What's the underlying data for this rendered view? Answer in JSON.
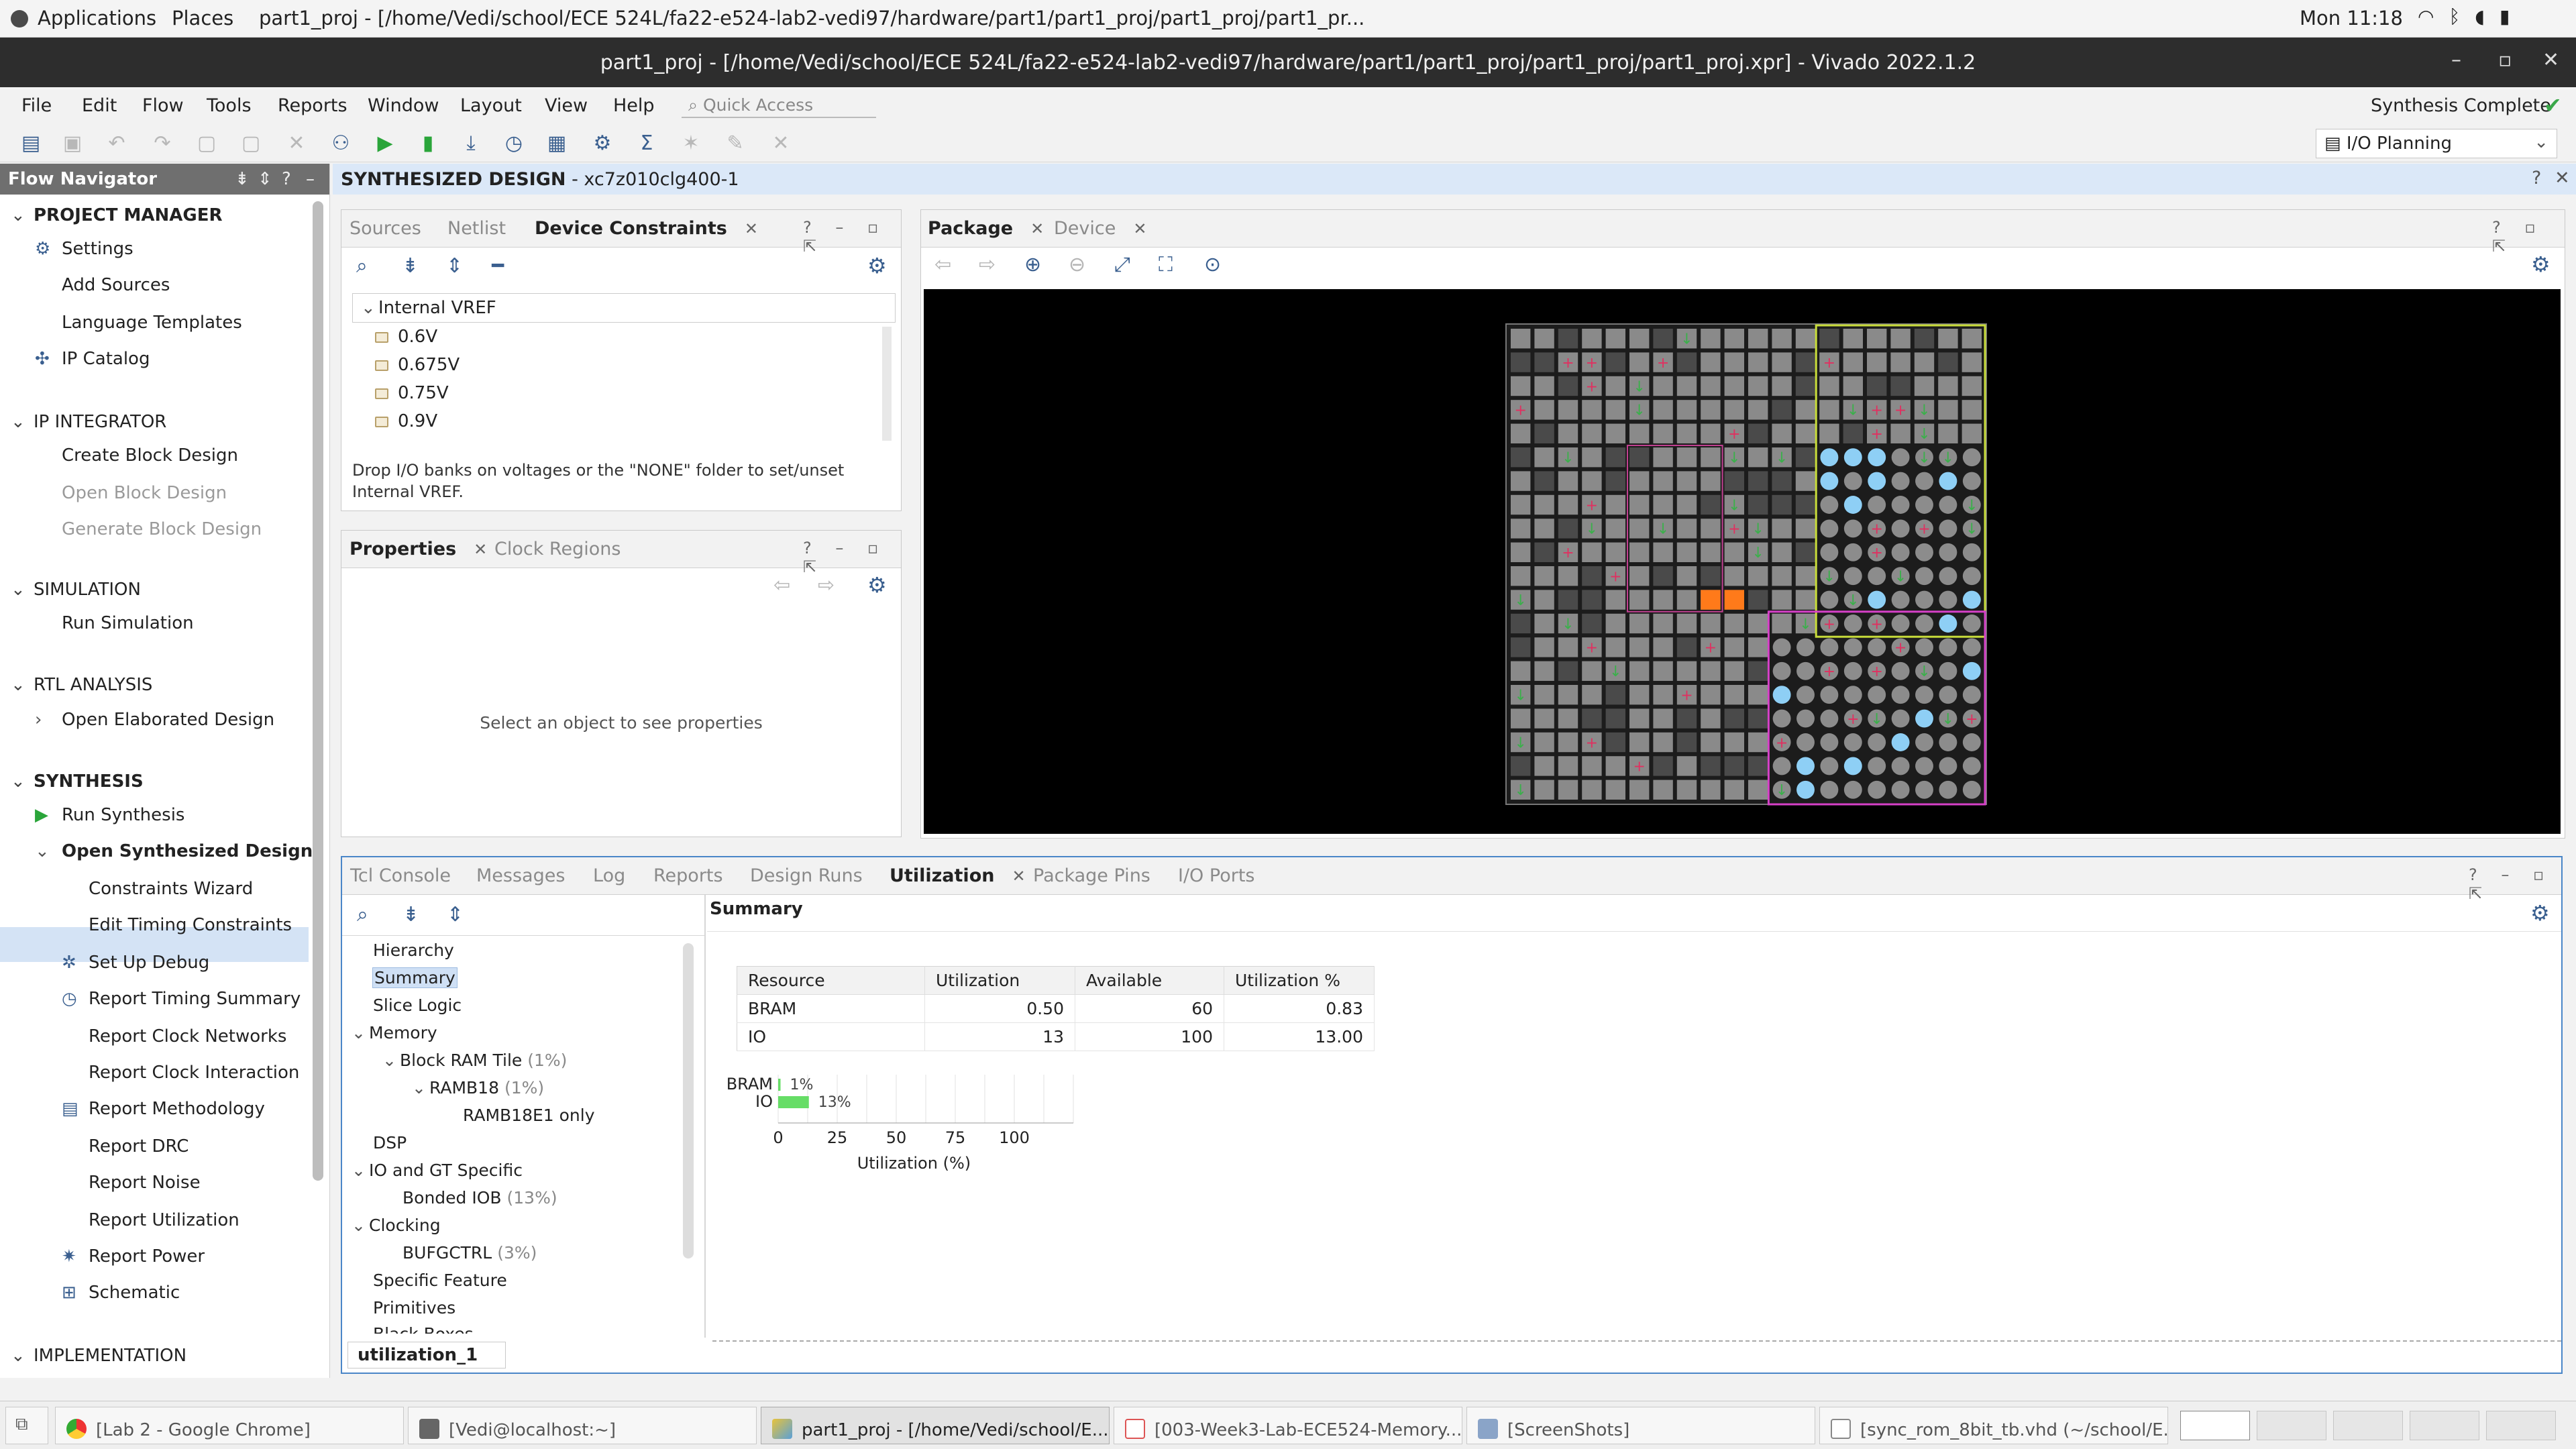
{
  "topbar": {
    "applications": "Applications",
    "places": "Places",
    "window_title": "part1_proj - [/home/Vedi/school/ECE 524L/fa22-e524-lab2-vedi97/hardware/part1/part1_proj/part1_proj/part1_pr...",
    "clock": "Mon 11:18"
  },
  "window": {
    "title": "part1_proj - [/home/Vedi/school/ECE 524L/fa22-e524-lab2-vedi97/hardware/part1/part1_proj/part1_proj/part1_proj.xpr] - Vivado 2022.1.2"
  },
  "menu": [
    "File",
    "Edit",
    "Flow",
    "Tools",
    "Reports",
    "Window",
    "Layout",
    "View",
    "Help"
  ],
  "quick_access_placeholder": "Quick Access",
  "status": {
    "text": "Synthesis Complete",
    "color": "#3aa84a"
  },
  "layout_select": "I/O Planning",
  "flow_navigator": {
    "title": "Flow Navigator",
    "sections": {
      "project_manager": "PROJECT MANAGER",
      "settings": "Settings",
      "add_sources": "Add Sources",
      "language_templates": "Language Templates",
      "ip_catalog": "IP Catalog",
      "ip_integrator": "IP INTEGRATOR",
      "create_block_design": "Create Block Design",
      "open_block_design": "Open Block Design",
      "generate_block_design": "Generate Block Design",
      "simulation": "SIMULATION",
      "run_simulation": "Run Simulation",
      "rtl_analysis": "RTL ANALYSIS",
      "open_elaborated_design": "Open Elaborated Design",
      "synthesis": "SYNTHESIS",
      "run_synthesis": "Run Synthesis",
      "open_synthesized_design": "Open Synthesized Design",
      "constraints_wizard": "Constraints Wizard",
      "edit_timing_constraints": "Edit Timing Constraints",
      "set_up_debug": "Set Up Debug",
      "report_timing_summary": "Report Timing Summary",
      "report_clock_networks": "Report Clock Networks",
      "report_clock_interaction": "Report Clock Interaction",
      "report_methodology": "Report Methodology",
      "report_drc": "Report DRC",
      "report_noise": "Report Noise",
      "report_utilization": "Report Utilization",
      "report_power": "Report Power",
      "schematic": "Schematic",
      "implementation": "IMPLEMENTATION"
    }
  },
  "design_header": {
    "title": "SYNTHESIZED DESIGN",
    "part": " - xc7z010clg400-1"
  },
  "constraints_panel": {
    "tabs": [
      "Sources",
      "Netlist",
      "Device Constraints"
    ],
    "group": "Internal VREF",
    "items": [
      "0.6V",
      "0.675V",
      "0.75V",
      "0.9V"
    ],
    "hint": "Drop I/O banks on voltages or the \"NONE\" folder to set/unset Internal VREF."
  },
  "properties_panel": {
    "tabs": [
      "Properties",
      "Clock Regions"
    ],
    "empty": "Select an object to see properties"
  },
  "package_panel": {
    "tabs": [
      "Package",
      "Device"
    ]
  },
  "bottom_panel": {
    "tabs": [
      "Tcl Console",
      "Messages",
      "Log",
      "Reports",
      "Design Runs",
      "Utilization",
      "Package Pins",
      "I/O Ports"
    ],
    "section_title": "Summary",
    "footer_tab": "utilization_1"
  },
  "util_tree": {
    "hierarchy": "Hierarchy",
    "summary": "Summary",
    "slice_logic": "Slice Logic",
    "memory": "Memory",
    "block_ram_tile": "Block RAM Tile",
    "block_ram_tile_pct": "(1%)",
    "ramb18": "RAMB18",
    "ramb18_pct": "(1%)",
    "ramb18e1": "RAMB18E1 only",
    "dsp": "DSP",
    "io_gt": "IO and GT Specific",
    "bonded_iob": "Bonded IOB",
    "bonded_iob_pct": "(13%)",
    "clocking": "Clocking",
    "bufgctrl": "BUFGCTRL",
    "bufgctrl_pct": "(3%)",
    "specific_feature": "Specific Feature",
    "primitives": "Primitives",
    "black_boxes": "Black Boxes"
  },
  "util_table": {
    "headers": [
      "Resource",
      "Utilization",
      "Available",
      "Utilization %"
    ],
    "rows": [
      [
        "BRAM",
        "0.50",
        "60",
        "0.83"
      ],
      [
        "IO",
        "13",
        "100",
        "13.00"
      ]
    ]
  },
  "chart_data": {
    "type": "bar",
    "orientation": "horizontal",
    "categories": [
      "BRAM",
      "IO"
    ],
    "values": [
      1,
      13
    ],
    "data_labels": [
      "1%",
      "13%"
    ],
    "xlabel": "Utilization (%)",
    "xticks": [
      "0",
      "25",
      "50",
      "75",
      "100"
    ],
    "xlim": [
      0,
      125
    ],
    "bar_color": "#66dd66"
  },
  "taskbar": {
    "tasks": [
      "[Lab 2 - Google Chrome]",
      "[Vedi@localhost:~]",
      "part1_proj - [/home/Vedi/school/E...",
      "[003-Week3-Lab-ECE524-Memory...",
      "[ScreenShots]",
      "[sync_rom_8bit_tb.vhd (~/school/E..."
    ]
  }
}
